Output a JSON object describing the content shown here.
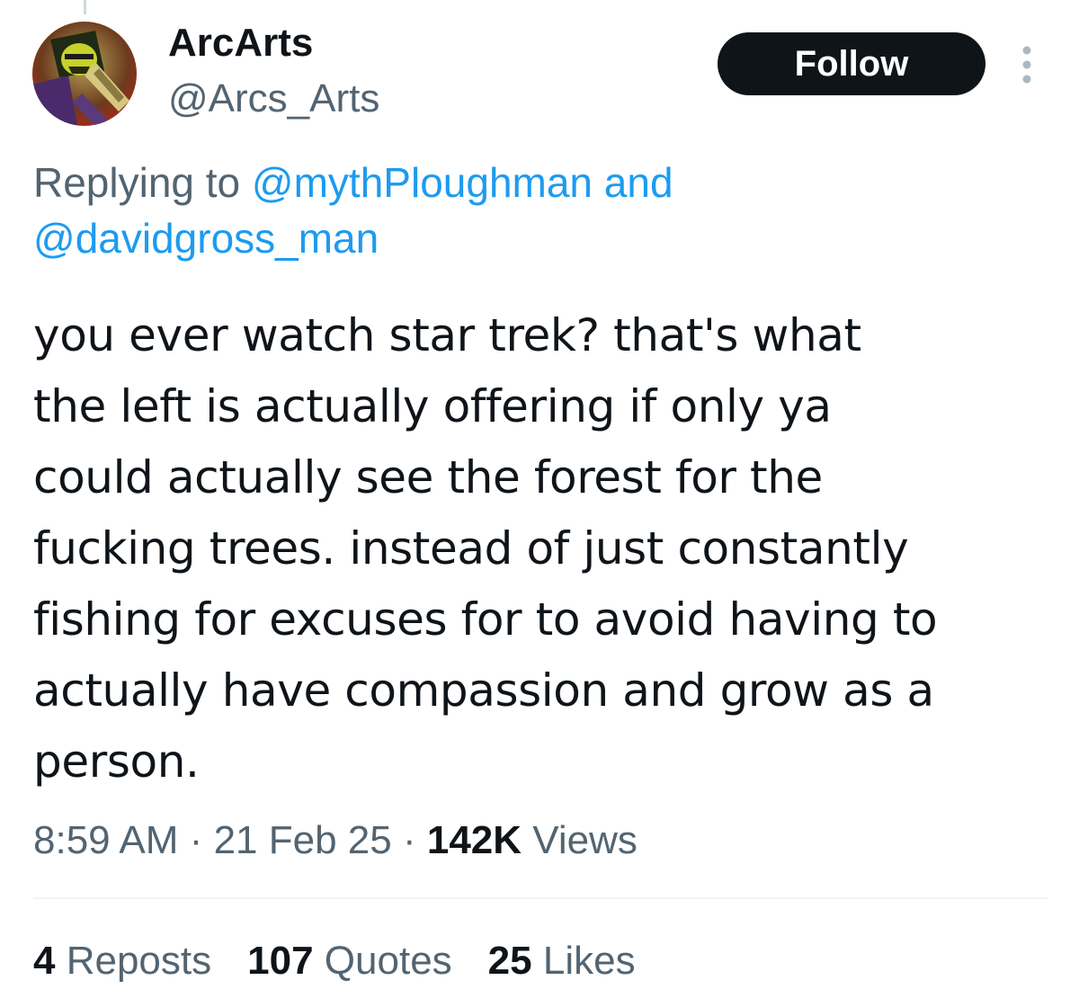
{
  "author": {
    "display_name": "ArcArts",
    "handle": "@Arcs_Arts"
  },
  "actions": {
    "follow_label": "Follow"
  },
  "reply_context": {
    "prefix": "Replying to ",
    "mention_1": "@mythPloughman",
    "joiner": " and",
    "mention_2": "@davidgross_man"
  },
  "tweet": {
    "lines": [
      "you ever watch star trek? that's what",
      "the left is actually offering if only ya",
      "could actually see the forest for the",
      "fucking trees. instead of just constantly",
      "fishing for excuses for to avoid having to",
      "actually have compassion and grow as a",
      "person."
    ]
  },
  "meta": {
    "time": "8:59 AM",
    "separator": "·",
    "date": "21 Feb 25",
    "views_count": "142K",
    "views_label": "Views"
  },
  "stats": {
    "reposts_count": "4",
    "reposts_label": "Reposts",
    "quotes_count": "107",
    "quotes_label": "Quotes",
    "likes_count": "25",
    "likes_label": "Likes"
  },
  "colors": {
    "text_primary": "#0f1419",
    "text_secondary": "#536471",
    "link": "#1d9bf0",
    "follow_bg": "#0f1419",
    "divider": "#eff3f4"
  },
  "icons": {
    "more": "more-vertical-icon",
    "avatar": "avatar"
  }
}
